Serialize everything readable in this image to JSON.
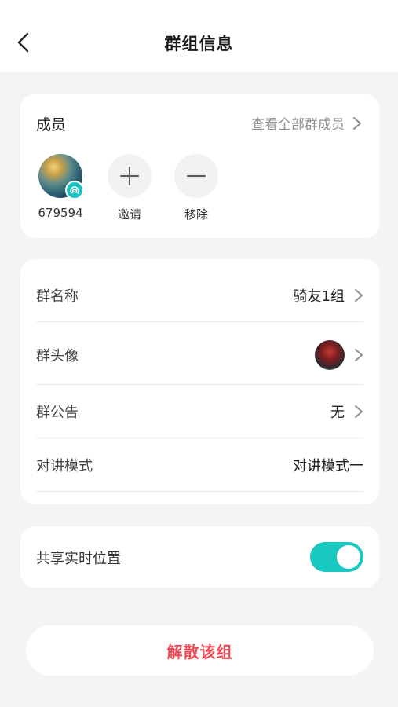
{
  "header": {
    "title": "群组信息"
  },
  "members": {
    "label": "成员",
    "view_all": "查看全部群成员",
    "items": [
      {
        "name": "679594"
      },
      {
        "name": "邀请"
      },
      {
        "name": "移除"
      }
    ]
  },
  "settings": {
    "rows": [
      {
        "label": "群名称",
        "value": "骑友1组"
      },
      {
        "label": "群头像",
        "value": ""
      },
      {
        "label": "群公告",
        "value": "无"
      },
      {
        "label": "对讲模式",
        "value": "对讲模式一"
      }
    ]
  },
  "share_location": {
    "label": "共享实时位置",
    "enabled": true
  },
  "dissolve": {
    "label": "解散该组"
  },
  "colors": {
    "accent": "#19c8c0",
    "danger": "#f24a55",
    "background": "#f4f4f5"
  }
}
